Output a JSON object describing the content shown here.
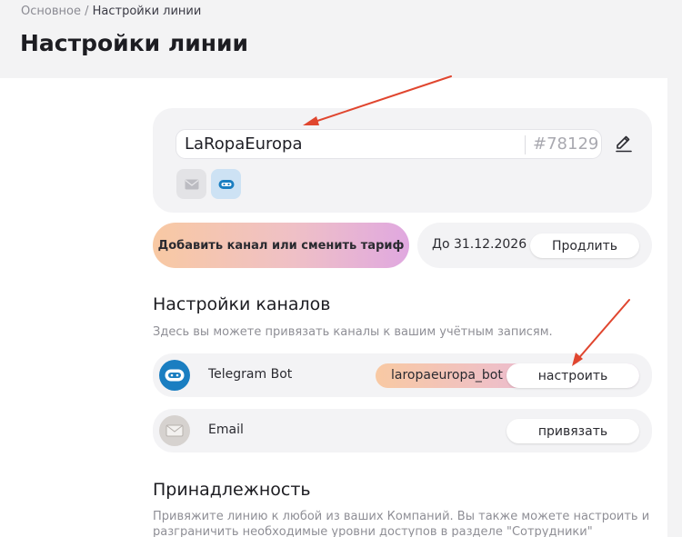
{
  "breadcrumb": {
    "root": "Основное",
    "separator": " / ",
    "current": "Настройки линии"
  },
  "page_title": "Настройки линии",
  "line": {
    "name": "LaRopaEuropa",
    "id": "#78129",
    "edit_icon": "pencil-icon",
    "channel_chips": [
      "email-icon",
      "telegram-bot-icon"
    ]
  },
  "tariff": {
    "add_channel_label": "Добавить канал или сменить тариф",
    "valid_until": "До 31.12.2026",
    "extend_label": "Продлить"
  },
  "channels_section": {
    "title": "Настройки каналов",
    "description": "Здесь вы можете привязать каналы к вашим учётным записям.",
    "items": [
      {
        "name": "Telegram Bot",
        "bot": "laropaeuropa_bot",
        "action": "настроить",
        "icon": "telegram-bot-icon",
        "icon_color": "#1a7ec1"
      },
      {
        "name": "Email",
        "bot": "",
        "action": "привязать",
        "icon": "email-icon",
        "icon_color": "#d6d2cf"
      }
    ]
  },
  "ownership_section": {
    "title": "Принадлежность",
    "description_line1": "Привяжите линию к любой из ваших Компаний. Вы также можете настроить и",
    "description_line2": "разграничить необходимые уровни доступов в разделе \"Сотрудники\""
  },
  "annotation_color": "#e0462f"
}
